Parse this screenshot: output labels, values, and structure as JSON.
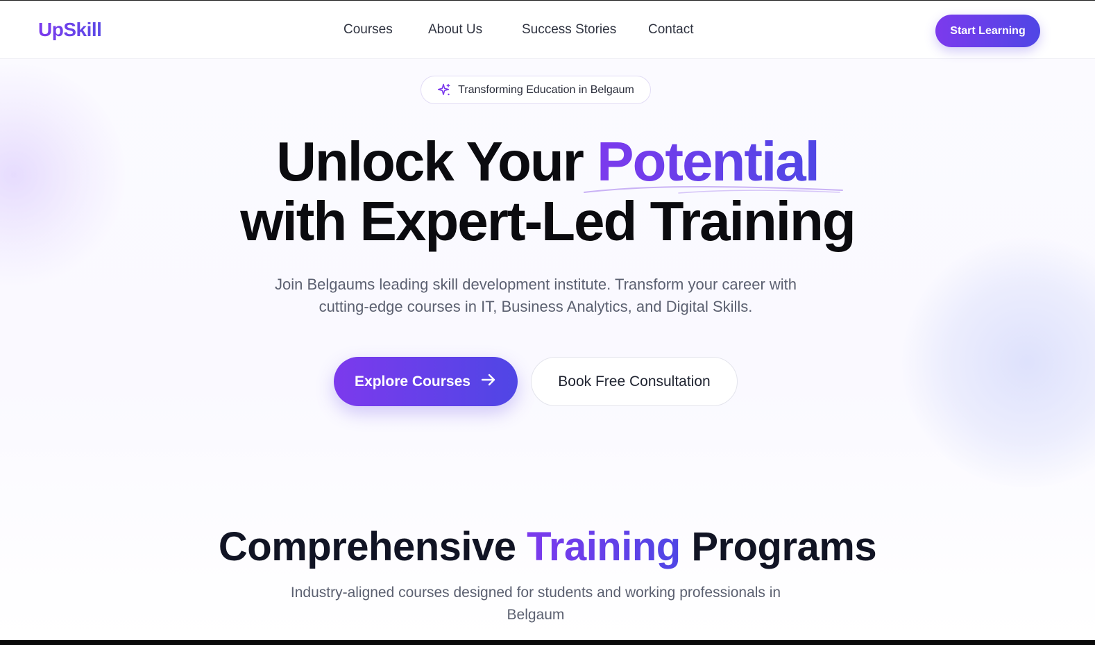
{
  "brand": {
    "logo": "UpSkill"
  },
  "nav": {
    "links": [
      "Courses",
      "About Us",
      "Success Stories",
      "Contact"
    ],
    "cta": "Start Learning"
  },
  "hero": {
    "badge": "Transforming Education in Belgaum",
    "headline_part1": "Unlock Your ",
    "headline_accent": "Potential",
    "headline_line2": "with Expert-Led Training",
    "subtext": "Join Belgaums leading skill development institute. Transform your career with cutting-edge courses in IT, Business Analytics, and Digital Skills.",
    "primary_button": "Explore Courses",
    "secondary_button": "Book Free Consultation"
  },
  "programs": {
    "title_part1": "Comprehensive ",
    "title_accent": "Training",
    "title_part2": " Programs",
    "subtitle": "Industry-aligned courses designed for students and working professionals in Belgaum"
  },
  "colors": {
    "accent_start": "#7c3aed",
    "accent_end": "#4f46e5",
    "text_dark": "#0b0b0f",
    "text_muted": "#5b6070"
  },
  "icons": {
    "badge": "sparkles-icon",
    "primary_button": "arrow-right-icon"
  }
}
